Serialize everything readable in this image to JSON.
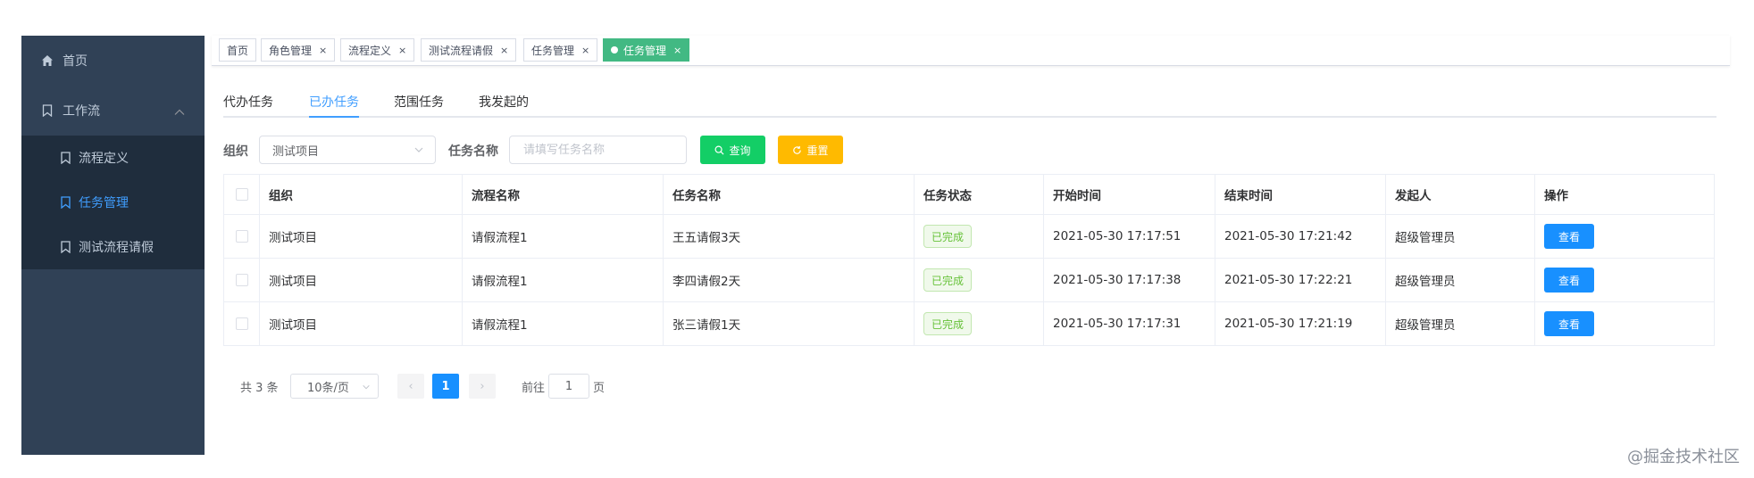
{
  "sidebar": {
    "home_label": "首页",
    "workflow_label": "工作流",
    "sub_items": [
      "流程定义",
      "任务管理",
      "测试流程请假"
    ]
  },
  "tags": [
    {
      "label": "首页"
    },
    {
      "label": "角色管理"
    },
    {
      "label": "流程定义"
    },
    {
      "label": "测试流程请假"
    },
    {
      "label": "任务管理"
    },
    {
      "label": "任务管理"
    }
  ],
  "tag_close": "×",
  "tabs": [
    "代办任务",
    "已办任务",
    "范围任务",
    "我发起的"
  ],
  "filter": {
    "org_label": "组织",
    "org_value": "测试项目",
    "task_name_label": "任务名称",
    "task_name_placeholder": "请填写任务名称",
    "search_label": "查询",
    "reset_label": "重置"
  },
  "table": {
    "headers": [
      "组织",
      "流程名称",
      "任务名称",
      "任务状态",
      "开始时间",
      "结束时间",
      "发起人",
      "操作"
    ],
    "rows": [
      {
        "org": "测试项目",
        "process": "请假流程1",
        "task": "王五请假3天",
        "status": "已完成",
        "start": "2021-05-30 17:17:51",
        "end": "2021-05-30 17:21:42",
        "initiator": "超级管理员",
        "action": "查看"
      },
      {
        "org": "测试项目",
        "process": "请假流程1",
        "task": "李四请假2天",
        "status": "已完成",
        "start": "2021-05-30 17:17:38",
        "end": "2021-05-30 17:22:21",
        "initiator": "超级管理员",
        "action": "查看"
      },
      {
        "org": "测试项目",
        "process": "请假流程1",
        "task": "张三请假1天",
        "status": "已完成",
        "start": "2021-05-30 17:17:31",
        "end": "2021-05-30 17:21:19",
        "initiator": "超级管理员",
        "action": "查看"
      }
    ]
  },
  "pagination": {
    "total": "共 3 条",
    "page_size": "10条/页",
    "prev": "‹",
    "next": "›",
    "current": "1",
    "goto_label": "前往",
    "goto_value": "1",
    "page_label": "页"
  },
  "watermark": "@掘金技术社区",
  "colors": {
    "sidebar_bg": "#304156",
    "submenu_bg": "#1f2d3d",
    "active_tag": "#42b983",
    "primary": "#1890ff",
    "success_btn": "#13ce66",
    "warning_btn": "#ffba00"
  }
}
